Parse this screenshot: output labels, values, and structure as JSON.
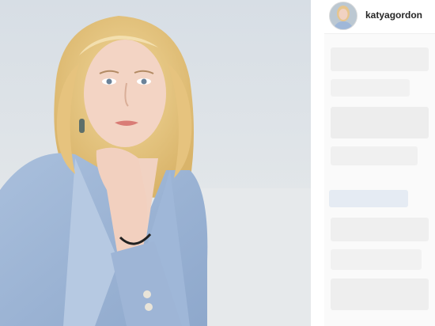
{
  "post": {
    "username": "katyagordon",
    "image": "portrait-photo"
  },
  "colors": {
    "background": "#ffffff",
    "sidebar": "#fafafa",
    "username_text": "#262626"
  }
}
